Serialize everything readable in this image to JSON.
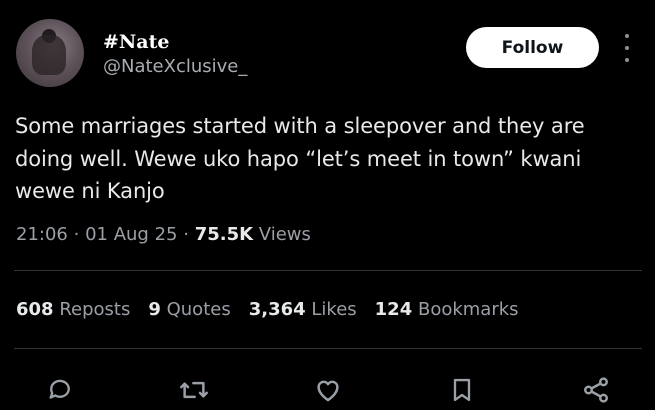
{
  "author": {
    "display_name": "#Nate",
    "handle": "@NateXclusive_"
  },
  "follow_label": "Follow",
  "tweet": {
    "line1": "Some marriages started with a sleepover and they are",
    "line2": "doing well. Wewe uko hapo “let’s meet in town” kwani",
    "line3": "wewe ni Kanjo"
  },
  "meta": {
    "time": "21:06",
    "date": "01 Aug 25",
    "views_count": "75.5K",
    "views_label": "Views",
    "separator": "·"
  },
  "stats": {
    "reposts_count": "608",
    "reposts_label": "Reposts",
    "quotes_count": "9",
    "quotes_label": "Quotes",
    "likes_count": "3,364",
    "likes_label": "Likes",
    "bookmarks_count": "124",
    "bookmarks_label": "Bookmarks"
  },
  "icons": {
    "reply": "reply-icon",
    "repost": "repost-icon",
    "like": "heart-icon",
    "bookmark": "bookmark-icon",
    "share": "share-icon",
    "more": "more-icon"
  },
  "colors": {
    "background": "#000000",
    "text": "#e7e9ea",
    "secondary": "#9aa0a6",
    "divider": "#2f3336",
    "button_bg": "#ffffff"
  }
}
